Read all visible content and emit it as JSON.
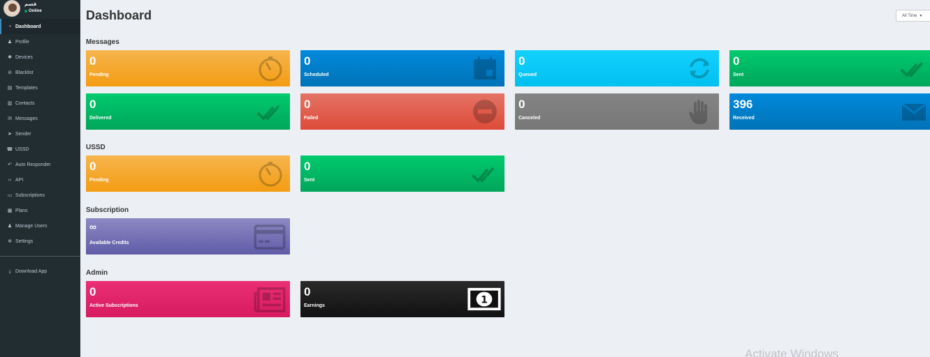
{
  "user": {
    "name": "قسم",
    "status": "Online"
  },
  "sidebar": {
    "items": [
      {
        "label": "Dashboard",
        "icon": "dashboard-icon",
        "glyph": "◔"
      },
      {
        "label": "Profile",
        "icon": "user-icon",
        "glyph": "♟"
      },
      {
        "label": "Devices",
        "icon": "gear-icon",
        "glyph": "✱"
      },
      {
        "label": "Blacklist",
        "icon": "ban-icon",
        "glyph": "⊘"
      },
      {
        "label": "Templates",
        "icon": "file-icon",
        "glyph": "▤"
      },
      {
        "label": "Contacts",
        "icon": "address-book-icon",
        "glyph": "▥"
      },
      {
        "label": "Messages",
        "icon": "envelope-icon",
        "glyph": "✉"
      },
      {
        "label": "Sender",
        "icon": "paper-plane-icon",
        "glyph": "➤"
      },
      {
        "label": "USSD",
        "icon": "phone-icon",
        "glyph": "☎"
      },
      {
        "label": "Auto Responder",
        "icon": "reply-icon",
        "glyph": "↶"
      },
      {
        "label": "API",
        "icon": "code-icon",
        "glyph": "‹›"
      },
      {
        "label": "Subscriptions",
        "icon": "ticket-icon",
        "glyph": "▭"
      },
      {
        "label": "Plans",
        "icon": "list-icon",
        "glyph": "▦"
      },
      {
        "label": "Manage Users",
        "icon": "users-icon",
        "glyph": "♟"
      },
      {
        "label": "Settings",
        "icon": "cog-icon",
        "glyph": "✲"
      }
    ],
    "download": {
      "label": "Download App",
      "icon": "download-icon",
      "glyph": "⤓"
    }
  },
  "header": {
    "title": "Dashboard",
    "range": "All Time"
  },
  "sections": {
    "messages": "Messages",
    "ussd": "USSD",
    "subscription": "Subscription",
    "admin": "Admin"
  },
  "messages": {
    "pending": {
      "value": "0",
      "label": "Pending",
      "color": "#f39c12"
    },
    "scheduled": {
      "value": "0",
      "label": "Scheduled",
      "color": "#0073b7"
    },
    "queued": {
      "value": "0",
      "label": "Queued",
      "color": "#00c0ef"
    },
    "sent": {
      "value": "0",
      "label": "Sent",
      "color": "#00a65a"
    },
    "delivered": {
      "value": "0",
      "label": "Delivered",
      "color": "#00a65a"
    },
    "failed": {
      "value": "0",
      "label": "Failed",
      "color": "#dd4b39"
    },
    "canceled": {
      "value": "0",
      "label": "Canceled",
      "color": "#777777"
    },
    "received": {
      "value": "396",
      "label": "Received",
      "color": "#0073b7"
    }
  },
  "ussd": {
    "pending": {
      "value": "0",
      "label": "Pending"
    },
    "sent": {
      "value": "0",
      "label": "Sent"
    }
  },
  "subscription": {
    "credits": {
      "value": "∞",
      "label": "Available Credits",
      "color": "#605ca8"
    }
  },
  "admin": {
    "active": {
      "value": "0",
      "label": "Active Subscriptions",
      "color": "#d81b60"
    },
    "earnings": {
      "value": "0",
      "label": "Earnings",
      "color": "#111111"
    }
  },
  "watermark": "Activate Windows"
}
